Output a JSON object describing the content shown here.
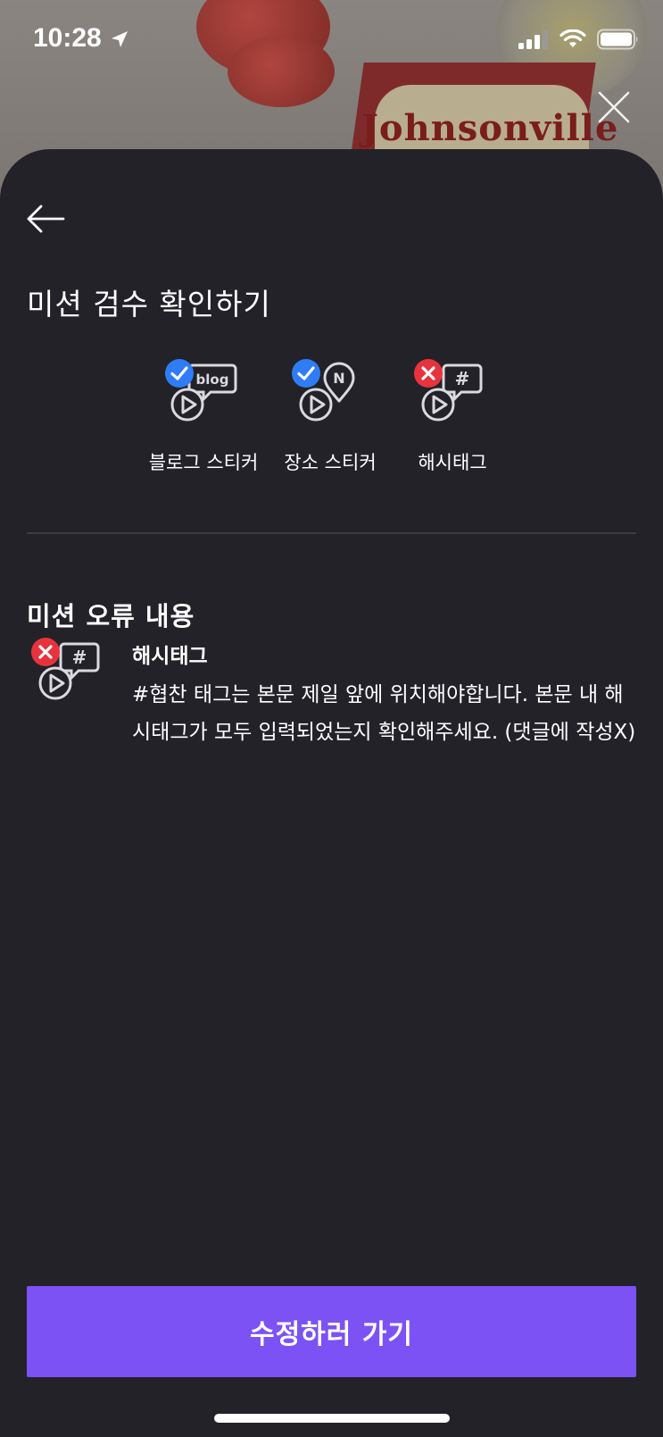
{
  "status_bar": {
    "time": "10:28"
  },
  "background": {
    "brand_text": "Johnsonville"
  },
  "sheet": {
    "title": "미션 검수 확인하기",
    "check_items": [
      {
        "label": "블로그 스티커",
        "badge_text": "blog",
        "status": "pass"
      },
      {
        "label": "장소 스티커",
        "badge_text": "N",
        "status": "pass"
      },
      {
        "label": "해시태그",
        "badge_text": "#",
        "status": "fail"
      }
    ],
    "error_section": {
      "title": "미션 오류 내용",
      "items": [
        {
          "title": "해시태그",
          "badge_text": "#",
          "description": "#협찬 태그는 본문 제일 앞에 위치해야합니다. 본문 내 해시태그가 모두 입력되었는지 확인해주세요. (댓글에 작성X)"
        }
      ]
    },
    "cta_label": "수정하러 가기"
  },
  "colors": {
    "sheet_background": "#232229",
    "accent": "#7c52f5",
    "pass_badge": "#2f7cf6",
    "fail_badge": "#e8333d",
    "icon_stroke": "#d9d9de"
  },
  "icons": {
    "back": "arrow-left-icon",
    "close": "close-icon",
    "pass": "check-circle-icon",
    "fail": "x-circle-icon",
    "sticker": "speech-bubble-play-icon"
  }
}
